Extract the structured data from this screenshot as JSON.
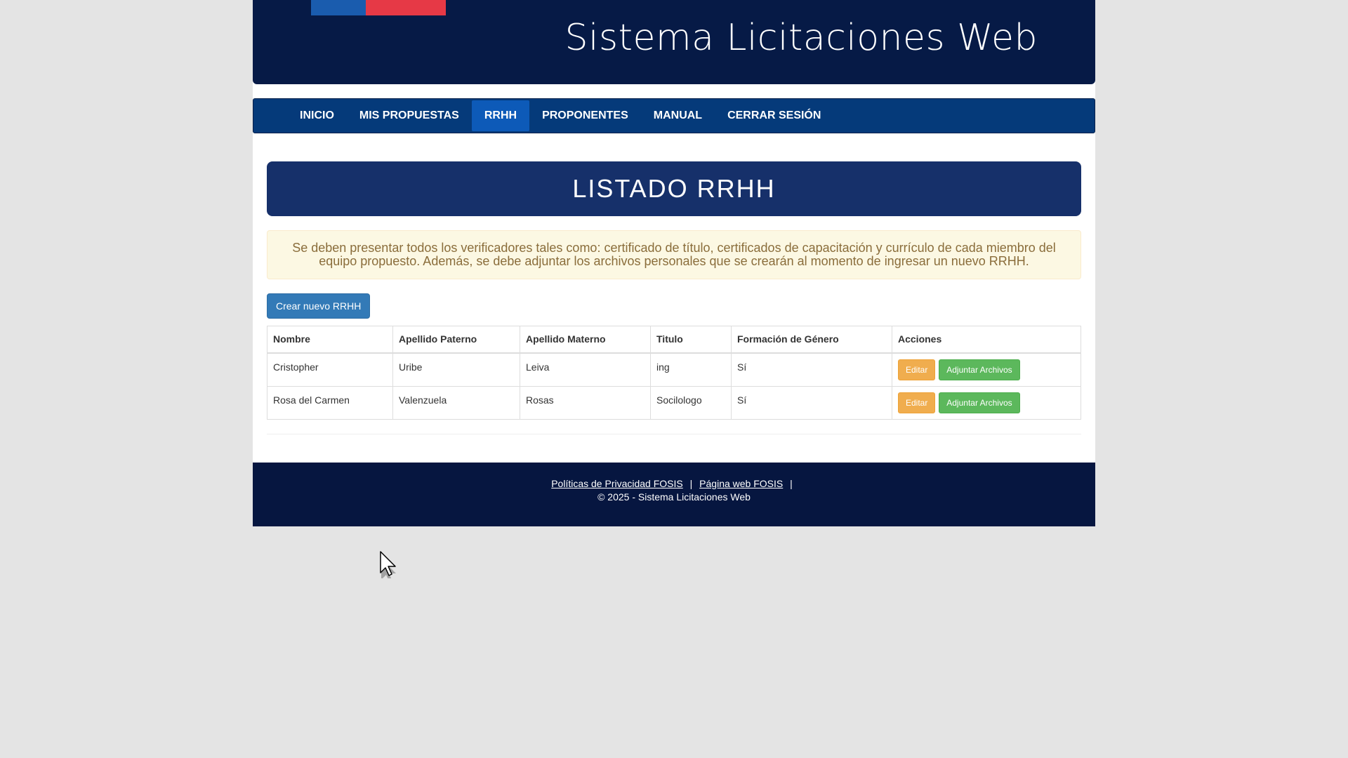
{
  "banner": {
    "title": "Sistema Licitaciones Web"
  },
  "nav": {
    "items": [
      {
        "label": "INICIO"
      },
      {
        "label": "MIS PROPUESTAS"
      },
      {
        "label": "RRHH"
      },
      {
        "label": "PROPONENTES"
      },
      {
        "label": "MANUAL"
      },
      {
        "label": "CERRAR SESIÓN"
      }
    ],
    "active": "RRHH"
  },
  "main": {
    "title": "LISTADO RRHH",
    "alert": "Se deben presentar todos los verificadores tales como: certificado de título, certificados de capacitación y currículo de cada miembro del equipo propuesto. Además, se debe adjuntar los archivos personales que se crearán al momento de ingresar un nuevo RRHH.",
    "create_button": "Crear nuevo RRHH"
  },
  "table": {
    "headers": [
      "Nombre",
      "Apellido Paterno",
      "Apellido Materno",
      "Titulo",
      "Formación de Género",
      "Acciones"
    ],
    "rows": [
      [
        "Cristopher",
        "Uribe",
        "Leiva",
        "ing",
        "Sí"
      ],
      [
        "Rosa del Carmen",
        "Valenzuela",
        "Rosas",
        "Socilologo",
        "Sí"
      ]
    ],
    "edit_label": "Editar",
    "attach_label": "Adjuntar Archivos"
  },
  "footer": {
    "privacy_link": "Políticas de Privacidad FOSIS",
    "web_link": "Página web FOSIS",
    "separator": "|",
    "copyright": "© 2025 - Sistema Licitaciones Web"
  },
  "colors": {
    "banner": "#061a46",
    "nav": "#053a7a",
    "nav_active": "#0d5ab8",
    "title_bar": "#16306a",
    "edit_button": "#f0ad4e",
    "attach_button": "#5cb85c",
    "create_button": "#337ab7"
  }
}
